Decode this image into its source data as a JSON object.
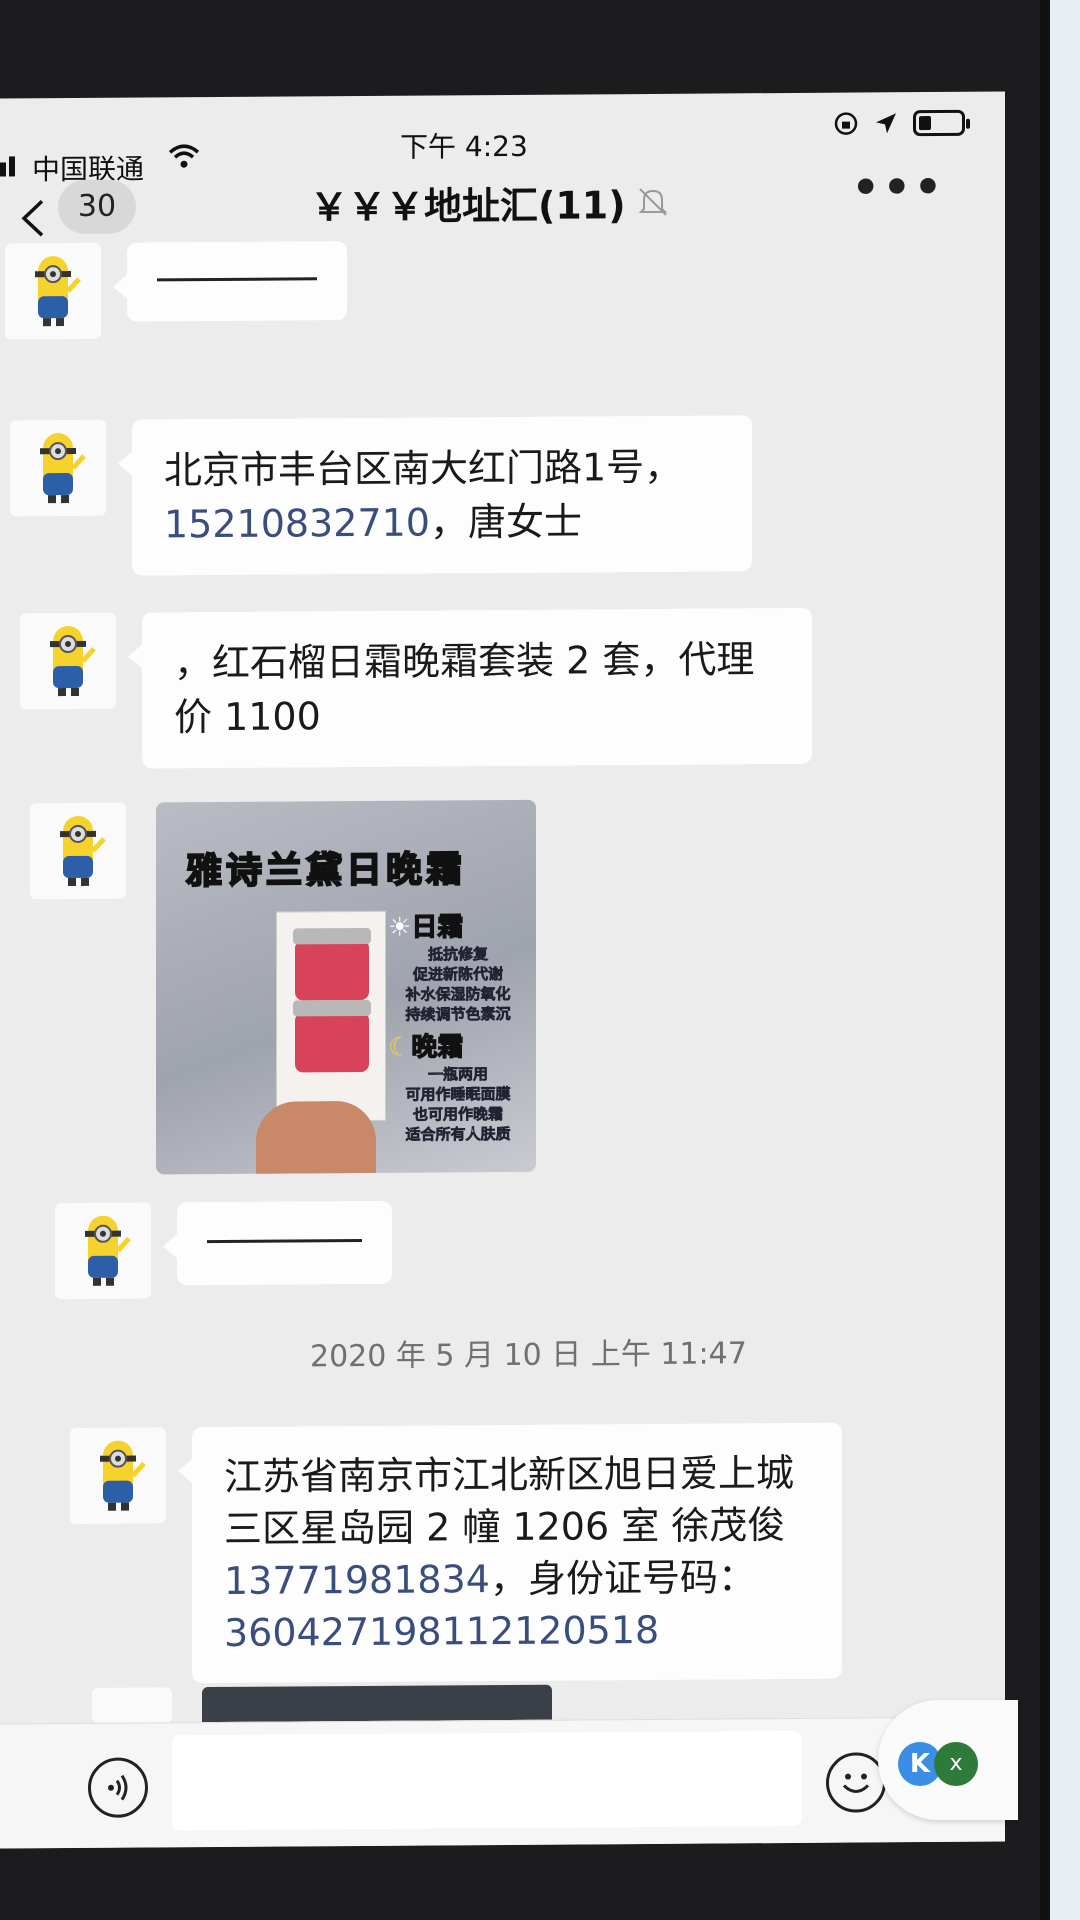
{
  "status_bar": {
    "carrier": "中国联通",
    "time": "下午 4:23",
    "battery_level": 0.3
  },
  "nav": {
    "back_count": "30",
    "title": "￥￥￥地址汇(11)"
  },
  "messages": [
    {
      "type": "text",
      "lines": [
        "————"
      ]
    },
    {
      "type": "text",
      "lines": [
        "北京市丰台区南大红门路1号，"
      ],
      "phone": "15210832710",
      "after_phone": "，唐女士"
    },
    {
      "type": "text",
      "lines": [
        "，红石榴日霜晚霜套装 2 套，代理",
        "价 1100"
      ]
    },
    {
      "type": "image",
      "title": "雅诗兰黛日晚霜",
      "day_head": "日霜",
      "day_lines": [
        "抵抗修复",
        "促进新陈代谢",
        "补水保湿防氧化",
        "持续调节色素沉"
      ],
      "night_head": "晚霜",
      "night_lines": [
        "一瓶两用",
        "可用作睡眠面膜",
        "也可用作晚霜",
        "适合所有人肤质"
      ]
    },
    {
      "type": "text",
      "lines": [
        "————"
      ]
    }
  ],
  "timestamp": "2020 年 5 月 10 日  上午 11:47",
  "message_2": {
    "lines": [
      "江苏省南京市江北新区旭日爱上城",
      "三区星岛园 2 幢 1206 室  徐茂俊"
    ],
    "phone": "13771981834",
    "after_phone": "，身份证号码：",
    "id_number": "360427198112120518"
  },
  "widget": {
    "k_label": "K",
    "x_label": "x"
  }
}
